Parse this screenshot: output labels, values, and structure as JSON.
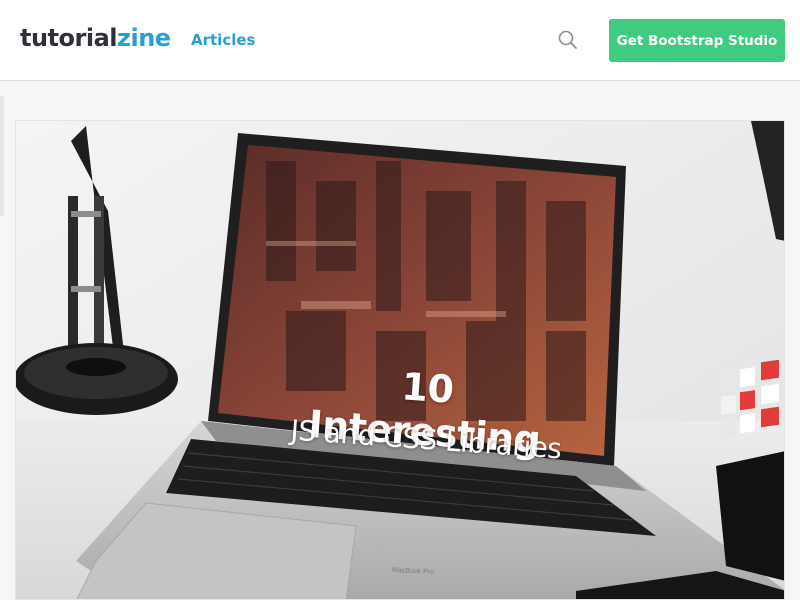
{
  "header": {
    "logo": {
      "part1": "tutorial",
      "part2": "zine"
    },
    "nav_articles": "Articles",
    "cta_label": "Get Bootstrap Studio",
    "search_icon": "search-icon"
  },
  "hero": {
    "title": "10 Interesting",
    "subtitle": "JS and CSS Libraries",
    "laptop_brand": "MacBook Pro"
  },
  "colors": {
    "brand_blue": "#2a9fd6",
    "cta_green": "#3fcc80",
    "logo_dark": "#2e3238"
  }
}
